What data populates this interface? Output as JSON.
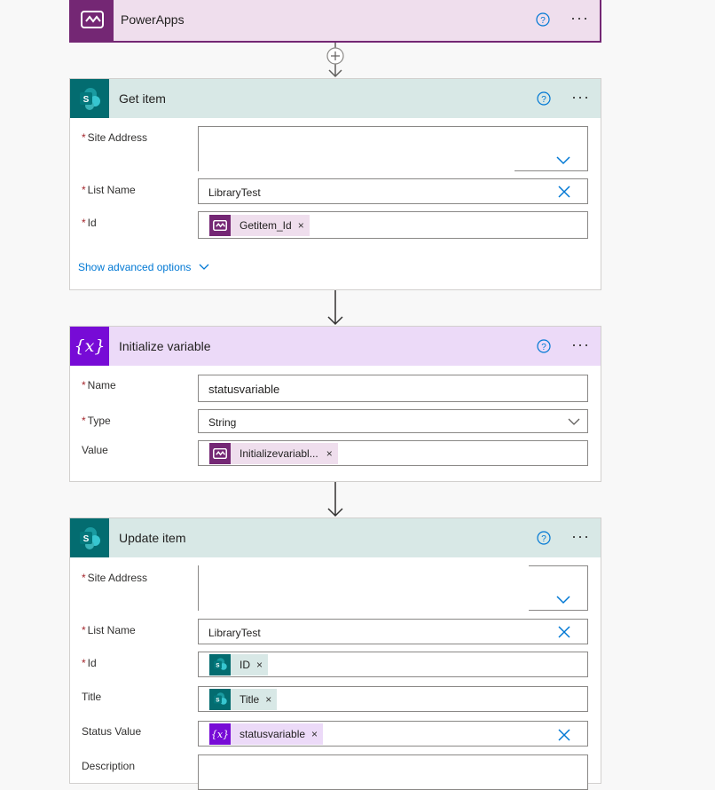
{
  "powerapps": {
    "title": "PowerApps",
    "help_icon": "question-circle-icon",
    "more_label": "···",
    "color": "#742774"
  },
  "get_item": {
    "title": "Get item",
    "more_label": "···",
    "site_address_label": "Site Address",
    "site_address_value": "",
    "list_name_label": "List Name",
    "list_name_value": "LibraryTest",
    "id_label": "Id",
    "id_token": "Getitem_Id",
    "show_advanced": "Show advanced options",
    "header_color": "#d8e8e6"
  },
  "init_var": {
    "title": "Initialize variable",
    "more_label": "···",
    "name_label": "Name",
    "name_value": "statusvariable",
    "type_label": "Type",
    "type_value": "String",
    "value_label": "Value",
    "value_token": "Initializevariabl...",
    "header_color": "#ecdaf8",
    "icon_glyph": "{x}"
  },
  "update_item": {
    "title": "Update item",
    "more_label": "···",
    "site_address_label": "Site Address",
    "site_address_value": "",
    "list_name_label": "List Name",
    "list_name_value": "LibraryTest",
    "id_label": "Id",
    "id_token": "ID",
    "title_label": "Title",
    "title_token": "Title",
    "status_label": "Status Value",
    "status_token": "statusvariable",
    "description_label": "Description",
    "header_color": "#d8e8e6"
  },
  "token_x": "×",
  "required_mark": "*"
}
